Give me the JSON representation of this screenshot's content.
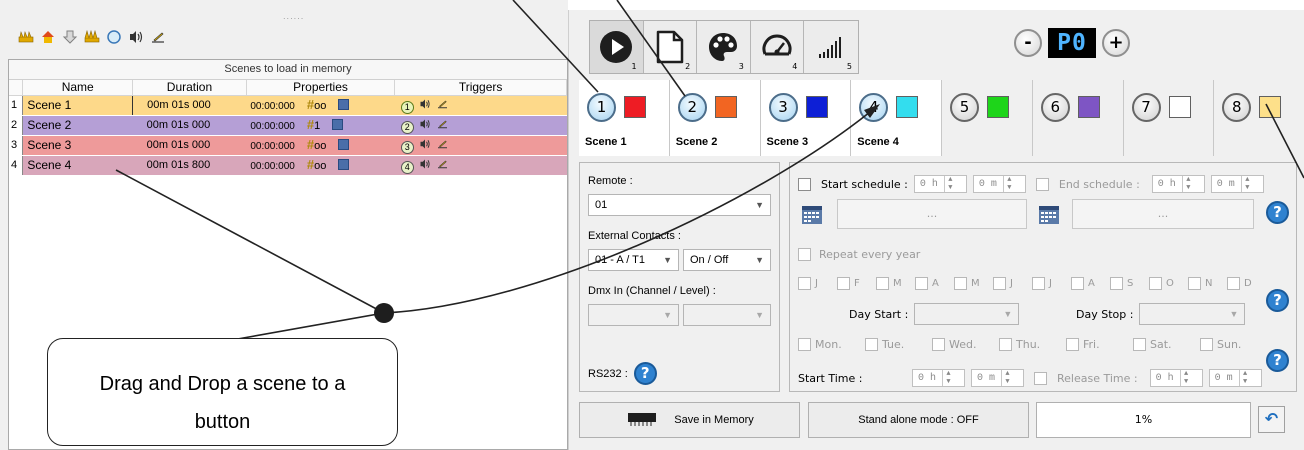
{
  "left": {
    "drag_handle": "......",
    "table_caption": "Scenes to load in memory",
    "columns": [
      "Name",
      "Duration",
      "Properties",
      "Triggers"
    ],
    "rows": [
      {
        "index": "1",
        "name": "Scene 1",
        "duration": "00m 01s 000",
        "time": "00:00:000",
        "count": "oo",
        "trigger_num": "1"
      },
      {
        "index": "2",
        "name": "Scene 2",
        "duration": "00m 01s 000",
        "time": "00:00:000",
        "count": "1",
        "trigger_num": "2"
      },
      {
        "index": "3",
        "name": "Scene 3",
        "duration": "00m 01s 000",
        "time": "00:00:000",
        "count": "oo",
        "trigger_num": "3"
      },
      {
        "index": "4",
        "name": "Scene 4",
        "duration": "00m 01s 800",
        "time": "00:00:000",
        "count": "oo",
        "trigger_num": "4"
      }
    ],
    "row_colors": [
      "#fdd98a",
      "#b59fd6",
      "#ee9a9a",
      "#d8a6ba"
    ],
    "toolbar_icons": [
      "fan-icon",
      "home-icon",
      "arrow-down-icon",
      "multi-fan-icon",
      "circle-icon",
      "sound-icon",
      "hand-write-icon"
    ]
  },
  "toolbar": {
    "tools": [
      {
        "icon": "play-icon",
        "sub": "1"
      },
      {
        "icon": "page-icon",
        "sub": "2"
      },
      {
        "icon": "palette-icon",
        "sub": "3"
      },
      {
        "icon": "gauge-icon",
        "sub": "4"
      },
      {
        "icon": "signal-bars-icon",
        "sub": "5"
      }
    ],
    "preset_minus": "-",
    "preset_value": "P0",
    "preset_plus": "+"
  },
  "scenes": [
    {
      "num": "1",
      "label": "Scene 1",
      "color": "#ee1c24",
      "active": true
    },
    {
      "num": "2",
      "label": "Scene 2",
      "color": "#f26522",
      "active": true
    },
    {
      "num": "3",
      "label": "Scene 3",
      "color": "#0d1fd6",
      "active": true
    },
    {
      "num": "4",
      "label": "Scene 4",
      "color": "#33ddee",
      "active": true
    },
    {
      "num": "5",
      "label": "",
      "color": "#1ed51a",
      "active": false
    },
    {
      "num": "6",
      "label": "",
      "color": "#7e55c4",
      "active": false
    },
    {
      "num": "7",
      "label": "",
      "color": "#ffffff",
      "active": false
    },
    {
      "num": "8",
      "label": "",
      "color": "#fde08a",
      "active": false
    }
  ],
  "settings": {
    "remote_label": "Remote :",
    "remote_value": "01",
    "ext_label": "External Contacts :",
    "ext_value": "01 - A / T1",
    "ext_mode": "On / Off",
    "dmx_label": "Dmx In (Channel / Level) :",
    "rs232_label": "RS232 :"
  },
  "schedule": {
    "start_label": "Start schedule :",
    "end_label": "End schedule :",
    "hours": "0 h",
    "minutes": "0 m",
    "date_placeholder": "...",
    "repeat_label": "Repeat every year",
    "months": [
      "J",
      "F",
      "M",
      "A",
      "M",
      "J",
      "J",
      "A",
      "S",
      "O",
      "N",
      "D"
    ],
    "day_start_label": "Day Start :",
    "day_stop_label": "Day Stop :",
    "weekdays": [
      "Mon.",
      "Tue.",
      "Wed.",
      "Thu.",
      "Fri.",
      "Sat.",
      "Sun."
    ],
    "start_time_label": "Start Time :",
    "release_time_label": "Release Time :"
  },
  "bottom": {
    "save_label": "Save in Memory",
    "standalone_label": "Stand alone mode : OFF",
    "progress_text": "1%"
  },
  "callout": {
    "line1": "Drag and Drop a scene to a",
    "line2": "button"
  }
}
